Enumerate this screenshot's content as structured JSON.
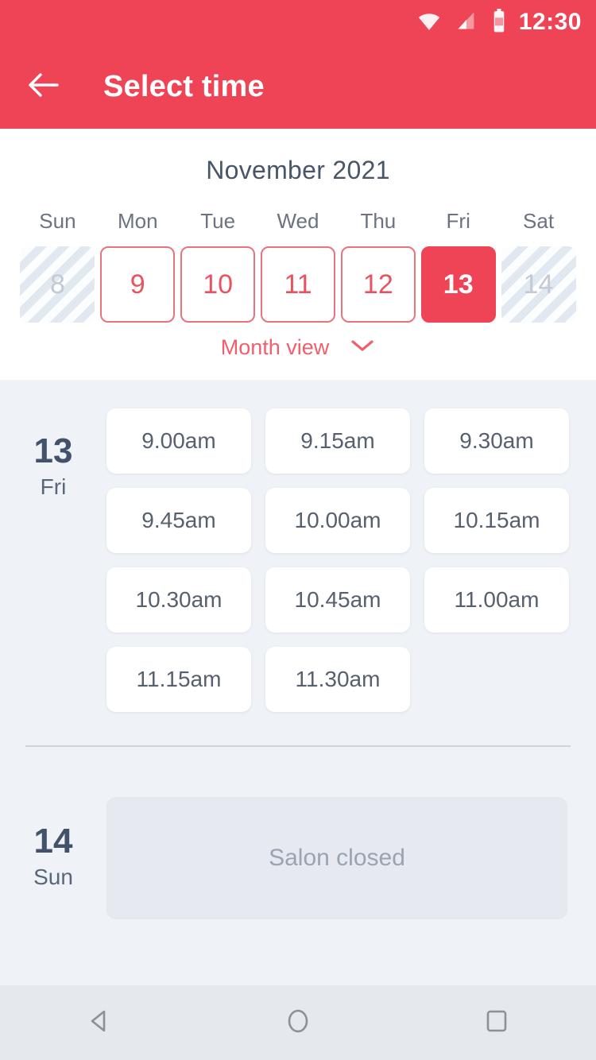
{
  "colors": {
    "accent": "#ef4455",
    "accent_light": "#ef5f6c",
    "day_border": "#e8737f",
    "panel_bg": "#eff2f7",
    "card_bg": "#ffffff",
    "text_dark": "#42526b",
    "text_muted": "#6b7280",
    "closed_bg": "#e6eaf0",
    "closed_text": "#9aa3b2",
    "navbar_bg": "#e5e8ed"
  },
  "statusbar": {
    "clock": "12:30",
    "icons": [
      "wifi-icon",
      "signal-icon",
      "battery-icon"
    ]
  },
  "appbar": {
    "back_icon": "back-arrow-icon",
    "title": "Select time"
  },
  "calendar": {
    "month_title": "November 2021",
    "weekday_headers": [
      "Sun",
      "Mon",
      "Tue",
      "Wed",
      "Thu",
      "Fri",
      "Sat"
    ],
    "days": [
      {
        "label": "8",
        "state": "disabled"
      },
      {
        "label": "9",
        "state": "available"
      },
      {
        "label": "10",
        "state": "available"
      },
      {
        "label": "11",
        "state": "available"
      },
      {
        "label": "12",
        "state": "available"
      },
      {
        "label": "13",
        "state": "selected"
      },
      {
        "label": "14",
        "state": "disabled"
      }
    ],
    "month_view": {
      "label": "Month view",
      "chevron_icon": "chevron-down-icon"
    }
  },
  "schedule": [
    {
      "date_number": "13",
      "weekday": "Fri",
      "slots": [
        "9.00am",
        "9.15am",
        "9.30am",
        "9.45am",
        "10.00am",
        "10.15am",
        "10.30am",
        "10.45am",
        "11.00am",
        "11.15am",
        "11.30am"
      ]
    },
    {
      "date_number": "14",
      "weekday": "Sun",
      "closed_message": "Salon closed"
    }
  ],
  "navbar": {
    "back_label": "back-nav-icon",
    "home_label": "home-nav-icon",
    "recents_label": "recents-nav-icon"
  }
}
